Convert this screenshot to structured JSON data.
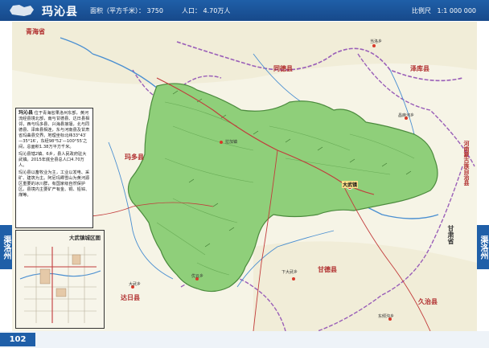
{
  "header": {
    "title": "玛沁县",
    "area": "面积（平方千米）：",
    "area_value": "3750",
    "population": "人口：",
    "population_value": "4.70万人",
    "scale_label": "比例尺",
    "scale_value": "1:1 000 000"
  },
  "side_left": "渠洛州",
  "side_right": "渠洛州",
  "page_number": "102",
  "intro": {
    "title": "玛沁县",
    "paragraphs": [
      "位于青海省果洛州东部，黄河流经县境北部，南与甘德县、达日县相邻，西与玛多县、兴海县接壤，北与同德县、泽库县相连，东与河南县及甘肃省玛曲县交界。地理坐标北纬33°43′—35°16′，东经98°52′—100°55′之间，总面积1.38万平方千米。",
      "玛沁县辖2镇、6乡，县人民政府驻大武镇。2015年底全县总人口4.70万人。",
      "玛沁县以畜牧业为主，工业以发电、采矿、建筑为主。阿尼玛卿雪山为黄河源区重要的冰川群，有国家级自然保护区。县境内主要矿产有金、铜、铅锌、煤等。"
    ]
  },
  "inset": {
    "title": "大武镇城区图"
  },
  "labels": {
    "region_top": "青海省",
    "region_east": "河南蒙古族自治县",
    "region_west": "玛多县",
    "region_south": "甘德县",
    "region_ne": "泽库县",
    "region_n": "同德县",
    "region_se": "久治县",
    "region_sw": "达日县",
    "region_e2": "甘肃省",
    "capital": "大武镇",
    "town1": "拉加镇",
    "town2": "下大武乡",
    "town3": "东倾沟乡",
    "town4": "当洛乡",
    "town5": "优云乡",
    "town6": "昌麻河乡",
    "town7": "大武乡"
  },
  "colors": {
    "header_bg": "#1f5fa8",
    "county_fill": "#8fcf7a",
    "background_map": "#f6f4e6"
  }
}
